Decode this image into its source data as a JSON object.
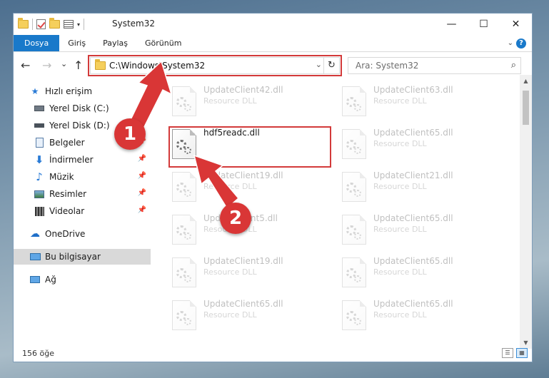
{
  "window": {
    "title": "System32",
    "controls": {
      "minimize": "—",
      "maximize": "☐",
      "close": "✕"
    }
  },
  "ribbon": {
    "tabs": [
      "Dosya",
      "Giriş",
      "Paylaş",
      "Görünüm"
    ]
  },
  "nav": {
    "back": "←",
    "forward": "→",
    "recent": "⌄",
    "up": "↑",
    "address": "C:\\Windows\\System32",
    "search_placeholder": "Ara: System32"
  },
  "sidebar": {
    "quick_access": "Hızlı erişim",
    "items": [
      {
        "label": "Yerel Disk (C:)",
        "icon": "drive-icon"
      },
      {
        "label": "Yerel Disk (D:)",
        "icon": "drive-icon"
      },
      {
        "label": "Belgeler",
        "icon": "documents-icon"
      },
      {
        "label": "İndirmeler",
        "icon": "download-icon"
      },
      {
        "label": "Müzik",
        "icon": "music-icon"
      },
      {
        "label": "Resimler",
        "icon": "pictures-icon"
      },
      {
        "label": "Videolar",
        "icon": "videos-icon"
      }
    ],
    "onedrive": "OneDrive",
    "this_pc": "Bu bilgisayar",
    "network": "Ağ"
  },
  "files": {
    "selected": {
      "name": "hdf5readc.dll",
      "type": ""
    },
    "left_column": [
      {
        "name": "UpdateClient42.dll",
        "type": "Resource DLL"
      },
      {
        "name": "UpdateClient19.dll",
        "type": "Resource DLL"
      },
      {
        "name": "UpdateClient5.dll",
        "type": "Resource DLL"
      },
      {
        "name": "UpdateClient19.dll",
        "type": "Resource DLL"
      },
      {
        "name": "UpdateClient65.dll",
        "type": "Resource DLL"
      }
    ],
    "right_column": [
      {
        "name": "UpdateClient63.dll",
        "type": "Resource DLL"
      },
      {
        "name": "UpdateClient65.dll",
        "type": "Resource DLL"
      },
      {
        "name": "UpdateClient21.dll",
        "type": "Resource DLL"
      },
      {
        "name": "UpdateClient65.dll",
        "type": "Resource DLL"
      },
      {
        "name": "UpdateClient65.dll",
        "type": "Resource DLL"
      },
      {
        "name": "UpdateClient65.dll",
        "type": "Resource DLL"
      }
    ]
  },
  "status": {
    "item_count": "156 öğe"
  },
  "annotations": {
    "step1": "1",
    "step2": "2",
    "color": "#d93636"
  }
}
